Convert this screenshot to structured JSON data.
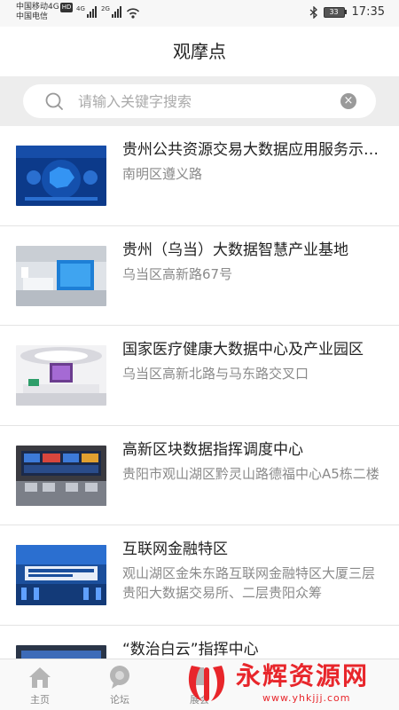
{
  "status_bar": {
    "carrier_line1": "中国移动4G",
    "hd": "HD",
    "carrier_line2": "中国电信",
    "sig1_label": "4G",
    "sig2_label": "2G",
    "battery": "33",
    "time": "17:35"
  },
  "page_title": "观摩点",
  "search": {
    "placeholder": "请输入关键字搜索",
    "value": ""
  },
  "items": [
    {
      "title": "贵州公共资源交易大数据应用服务示范基地",
      "address": "南明区遵义路"
    },
    {
      "title": "贵州（乌当）大数据智慧产业基地",
      "address": "乌当区高新路67号"
    },
    {
      "title": "国家医疗健康大数据中心及产业园区",
      "address": "乌当区高新北路与马东路交叉口"
    },
    {
      "title": "高新区块数据指挥调度中心",
      "address": "贵阳市观山湖区黔灵山路德福中心A5栋二楼"
    },
    {
      "title": "互联网金融特区",
      "address": "观山湖区金朱东路互联网金融特区大厦三层贵阳大数据交易所、二层贵阳众筹"
    },
    {
      "title": "“数治白云”指挥中心",
      "address": ""
    }
  ],
  "tabs": [
    {
      "label": "主页",
      "icon": "home-icon"
    },
    {
      "label": "论坛",
      "icon": "chat-bubble-icon"
    },
    {
      "label": "展会",
      "icon": "exhibition-icon"
    }
  ],
  "watermark": {
    "text": "永辉资源网",
    "url": "www.yhkjjj.com"
  },
  "colors": {
    "accent_red": "#e8262b",
    "search_bg": "#ededed",
    "muted_text": "#8a8a8a"
  }
}
